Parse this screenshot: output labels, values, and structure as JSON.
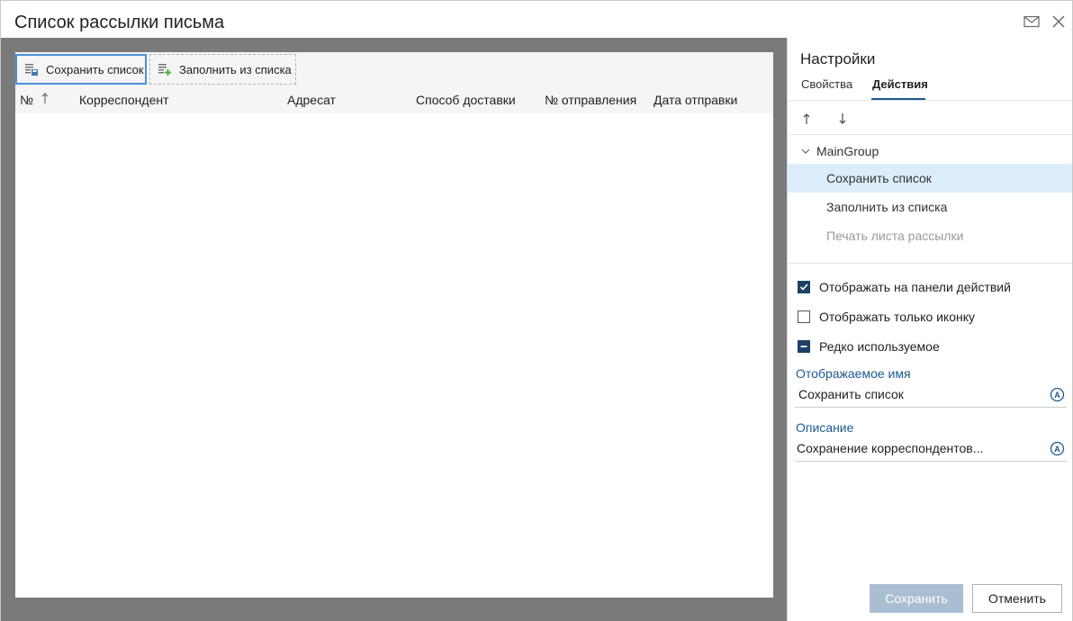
{
  "window": {
    "title": "Список рассылки письма"
  },
  "toolbar": {
    "save_list_label": "Сохранить список",
    "fill_from_list_label": "Заполнить из списка"
  },
  "table": {
    "columns": [
      "№",
      "Корреспондент",
      "Адресат",
      "Способ доставки",
      "№ отправления",
      "Дата отправки"
    ],
    "sort_icon": "sort-ascending-icon",
    "rows": []
  },
  "settings": {
    "title": "Настройки",
    "tabs": [
      {
        "label": "Свойства",
        "active": false
      },
      {
        "label": "Действия",
        "active": true
      }
    ],
    "tree": {
      "group_label": "MainGroup",
      "items": [
        {
          "label": "Сохранить список",
          "state": "selected"
        },
        {
          "label": "Заполнить из списка",
          "state": "normal"
        },
        {
          "label": "Печать листа рассылки",
          "state": "disabled"
        }
      ]
    },
    "checkboxes": [
      {
        "label": "Отображать на панели действий",
        "state": "checked"
      },
      {
        "label": "Отображать только иконку",
        "state": "unchecked"
      },
      {
        "label": "Редко используемое",
        "state": "indeterminate"
      }
    ],
    "display_name": {
      "label": "Отображаемое имя",
      "value": "Сохранить список"
    },
    "description": {
      "label": "Описание",
      "value": "Сохранение корреспондентов..."
    },
    "save_label": "Сохранить",
    "cancel_label": "Отменить"
  },
  "colors": {
    "accent": "#1d5a8f",
    "selection": "#dceefb",
    "editor_background": "#7a7a7a",
    "focus_border": "#4a90d9",
    "checkbox_fill": "#1e3f66",
    "disabled_button": "#a9bed3"
  }
}
